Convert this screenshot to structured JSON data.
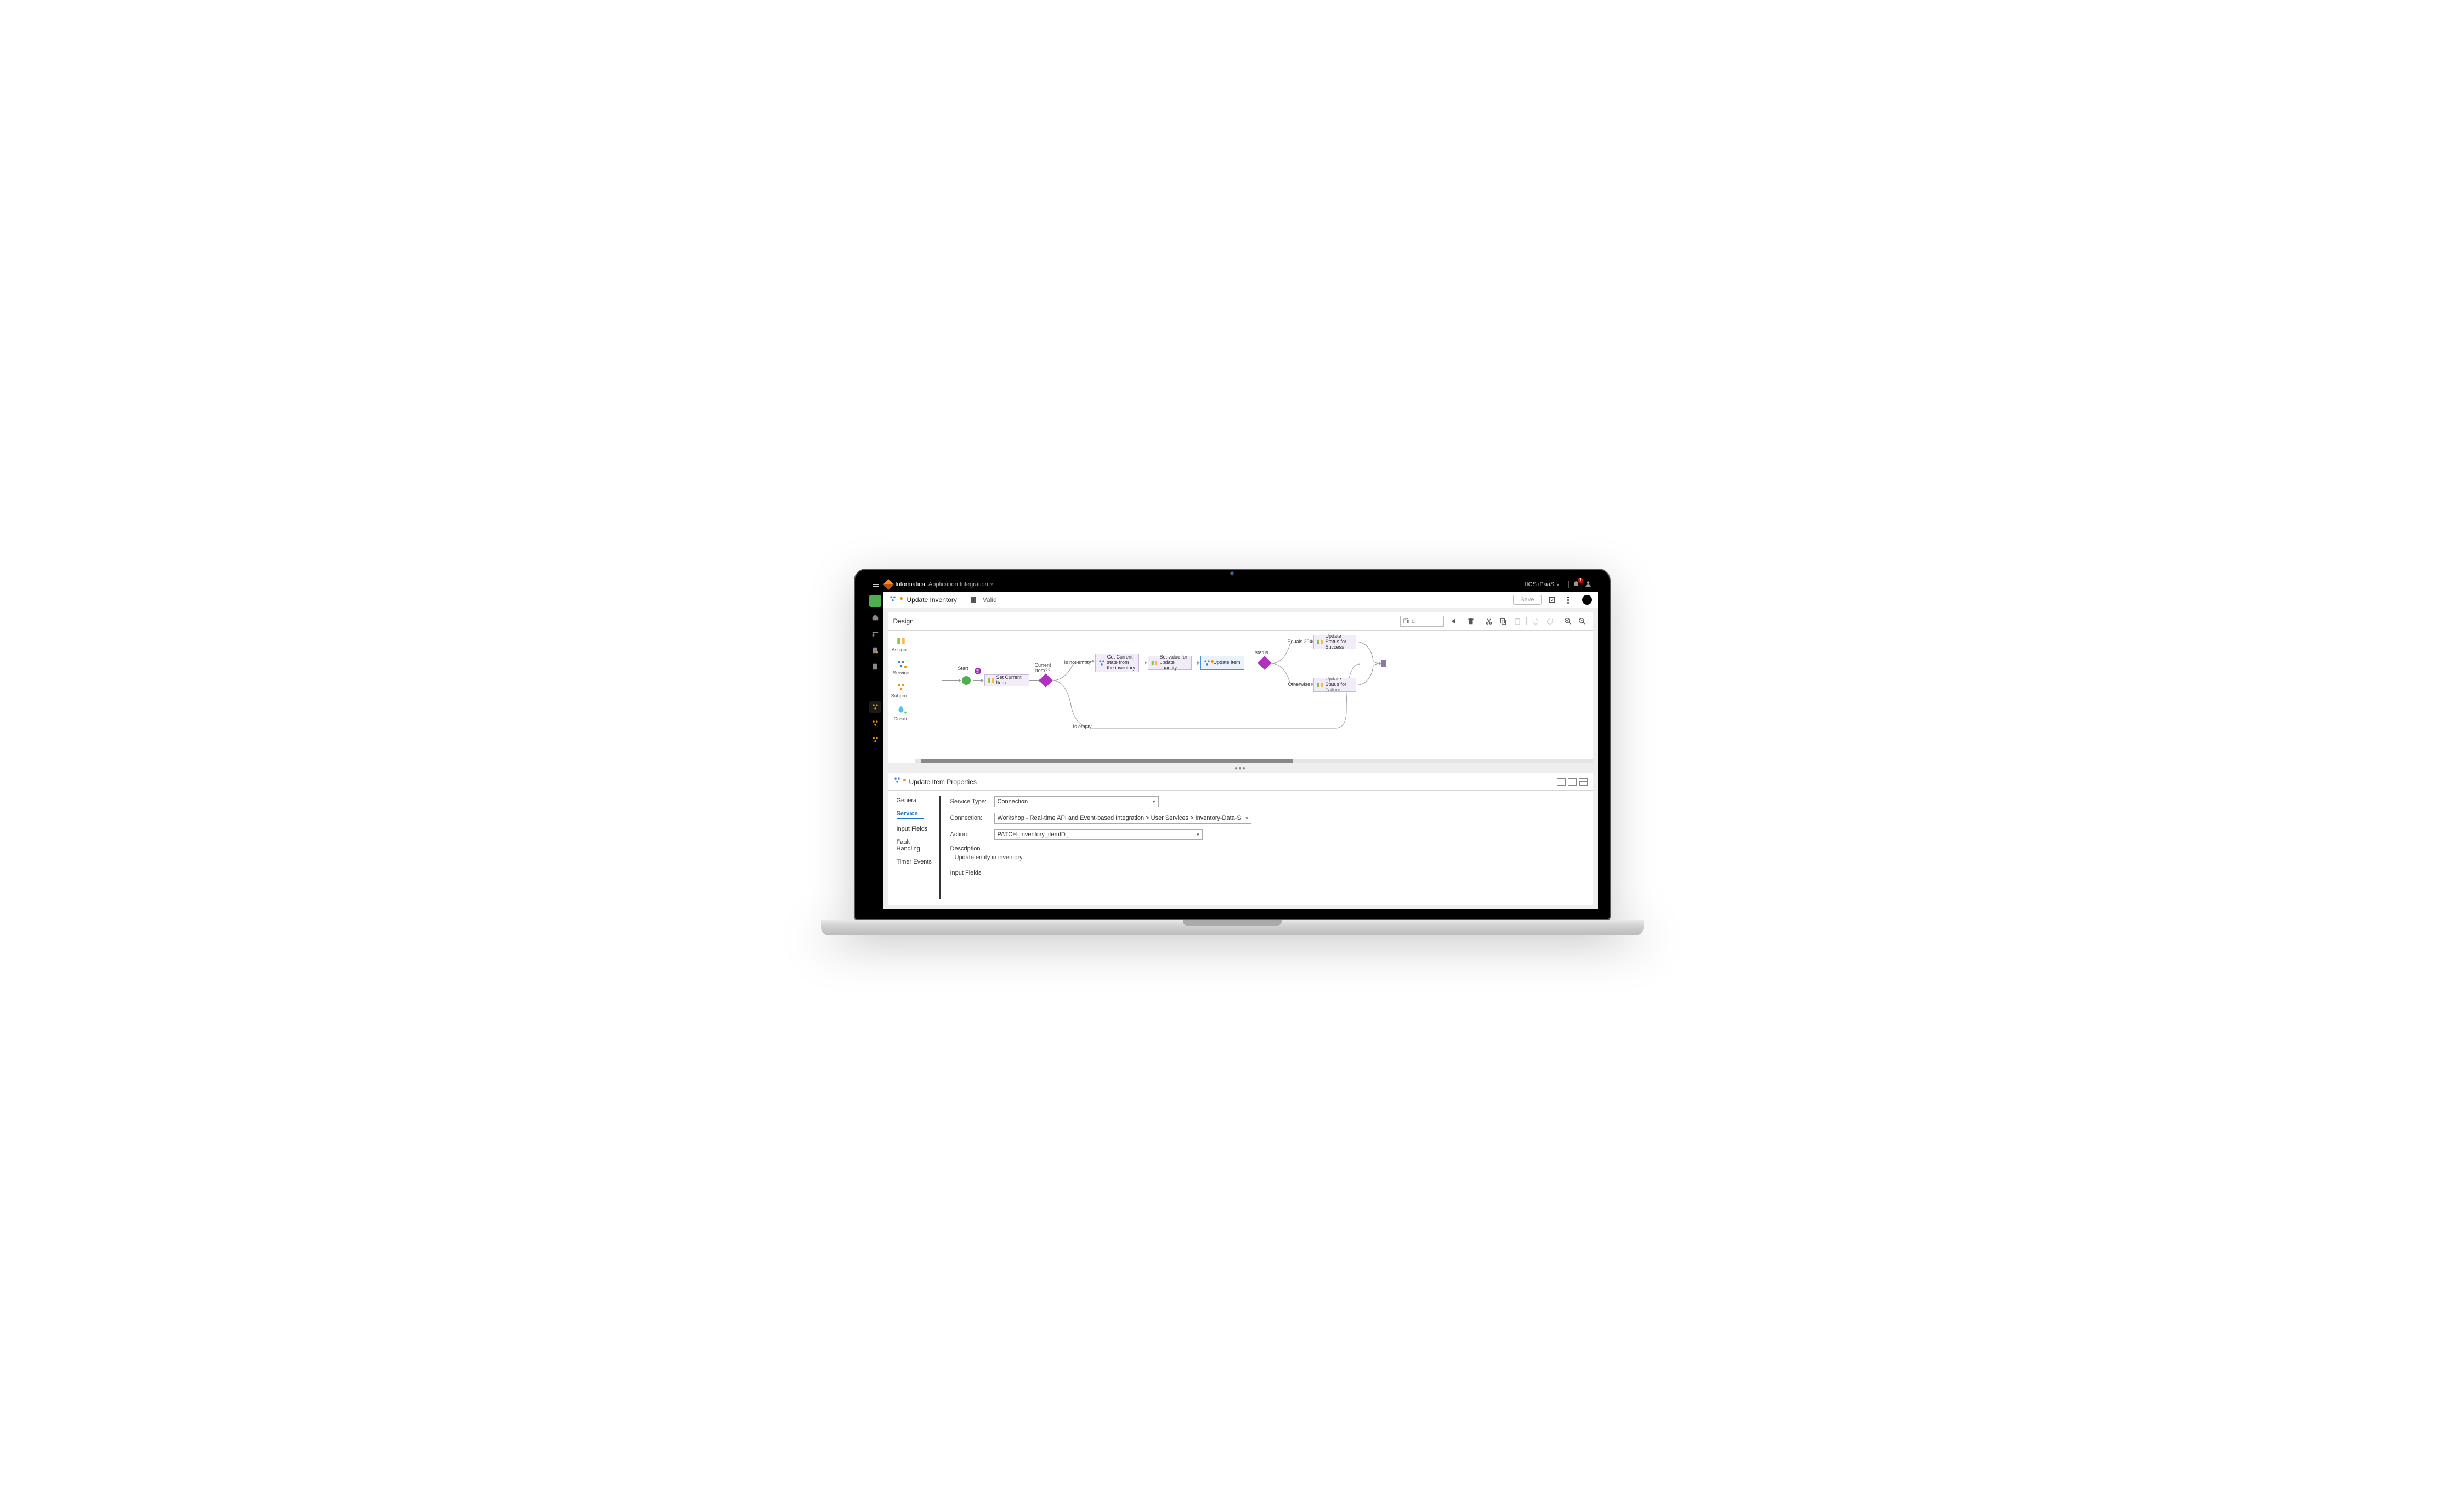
{
  "topbar": {
    "brand": "Informatica",
    "app": "Application Integration",
    "tenant": "IICS iPaaS",
    "badge": "1"
  },
  "rail": {
    "new": "+"
  },
  "subheader": {
    "title": "Update Inventory",
    "status": "Valid",
    "save": "Save"
  },
  "design": {
    "title": "Design",
    "find_placeholder": "Find"
  },
  "palette": {
    "items": [
      {
        "label": "Assign..."
      },
      {
        "label": "Service"
      },
      {
        "label": "Subpro..."
      },
      {
        "label": "Create"
      }
    ]
  },
  "flow": {
    "start": "Start",
    "set_current_item": "Set Current Item",
    "current_item_q": "Current Item??",
    "is_not_empty": "Is not empty",
    "is_empty": "Is empty",
    "get_current_state": "Get Current state from the inventory",
    "set_value": "Set value for update quantity",
    "update_item": "Update Item",
    "status": "status",
    "equals_204": "Equals 204",
    "otherwise": "Otherwise",
    "update_success": "Update Status for Success",
    "update_failure": "Update Status for Failure"
  },
  "props": {
    "title": "Update Item Properties",
    "tabs": {
      "general": "General",
      "service": "Service",
      "input_fields": "Input Fields",
      "fault_handling": "Fault Handling",
      "timer_events": "Timer Events"
    },
    "form": {
      "service_type_label": "Service Type:",
      "service_type_value": "Connection",
      "connection_label": "Connection:",
      "connection_value": "Workshop - Real-time API and Event-based Integration > User Services > Inventory-Data-S",
      "action_label": "Action:",
      "action_value": "PATCH_inventory_itemID_",
      "description_label": "Description",
      "description_value": "Update entity in inventory",
      "input_fields_label": "Input Fields"
    }
  }
}
